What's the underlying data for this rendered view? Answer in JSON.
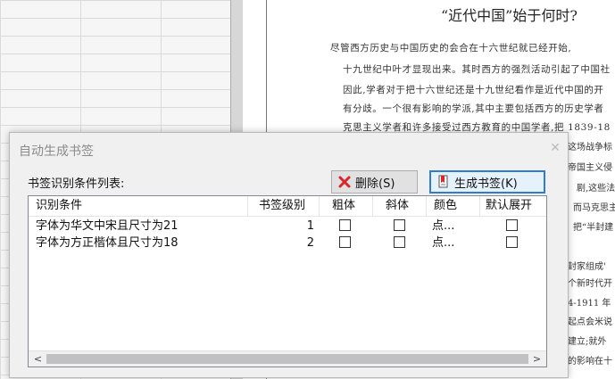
{
  "document": {
    "title": "“近代中国”始于何时?",
    "lines": [
      "尽管西方历史与中国历史的会合在十六世纪就已经开始,",
      "十九世纪中叶才显现出来。其时西方的强烈活动引起了中国社",
      "因此,学者对于把十六世纪还是十九世纪看作是近代中国的开",
      "有分歧。一个很有影响的学派,其中主要包括西方的历史学者",
      "克思主义学者和许多接受过西方教育的中国学者,把 1839-18"
    ],
    "fragments": [
      "这场战争标",
      "帝国主义侵",
      "剧,这些法",
      "而马克思主",
      "把“半封建",
      "封家组成'",
      "个新时代开",
      "4-1911 年",
      "起点会米说",
      "建立;就外",
      "的影响在十"
    ]
  },
  "dialog": {
    "title": "自动生成书签",
    "close_glyph": "✕",
    "list_label": "书签识别条件列表:",
    "delete_button": "删除(S)",
    "generate_button": "生成书签(K)",
    "columns": [
      "识别条件",
      "书签级别",
      "粗体",
      "斜体",
      "颜色",
      "默认展开"
    ],
    "rows": [
      {
        "condition": "字体为华文中宋且尺寸为21",
        "level": "1",
        "bold": false,
        "italic": false,
        "color": "点...",
        "expand": false
      },
      {
        "condition": "字体为方正楷体且尺寸为18",
        "level": "2",
        "bold": false,
        "italic": false,
        "color": "点...",
        "expand": false
      }
    ],
    "scroll_left": "<",
    "scroll_right": ">"
  }
}
